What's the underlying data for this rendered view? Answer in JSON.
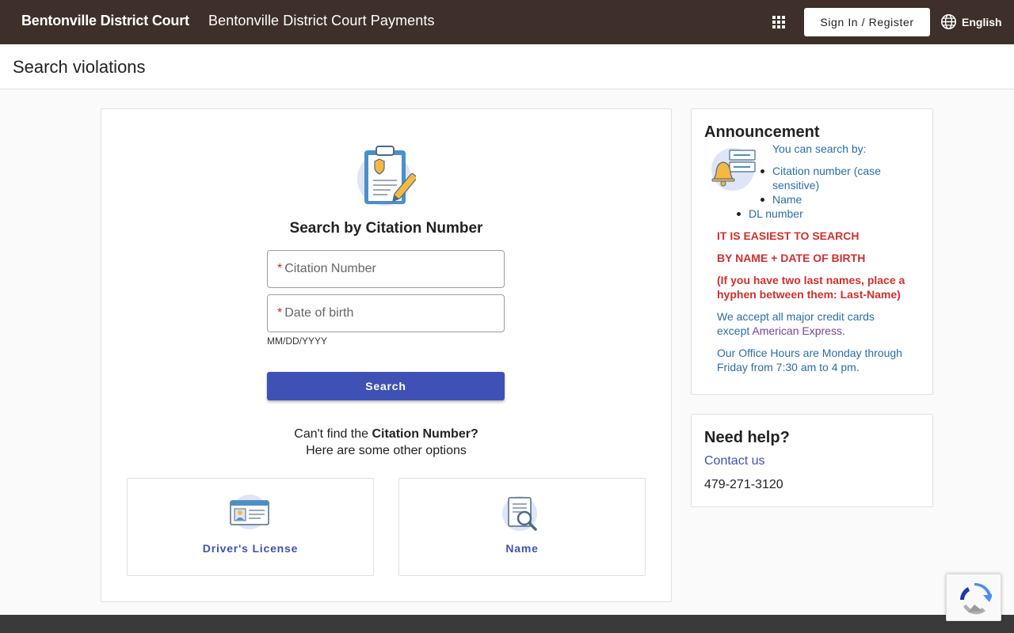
{
  "header": {
    "court_name": "Bentonville District Court",
    "app_title": "Bentonville District Court Payments",
    "signin_label": "Sign In / Register",
    "language": "English"
  },
  "page": {
    "title": "Search violations"
  },
  "search": {
    "heading": "Search by Citation Number",
    "citation_placeholder": "Citation Number",
    "dob_placeholder": "Date of birth",
    "dob_hint": "MM/DD/YYYY",
    "search_label": "Search",
    "cant_find_prefix": "Can't find the ",
    "cant_find_bold": "Citation Number?",
    "other_options": "Here are some other options",
    "options": [
      {
        "label": "Driver's License",
        "icon": "drivers-license-icon"
      },
      {
        "label": "Name",
        "icon": "name-search-icon"
      }
    ]
  },
  "announcement": {
    "title": "Announcement",
    "intro": "You can search by:",
    "items": [
      "Citation number (case sensitive)",
      "Name",
      "DL number"
    ],
    "red_line_1": "IT IS EASIEST TO SEARCH",
    "red_line_2": "BY NAME + DATE OF BIRTH",
    "red_line_3": "(If you have two last names, place a hyphen between them: Last-Name)",
    "cards_text": "We accept all major credit cards except ",
    "cards_amex": "American Express",
    "cards_end": ".",
    "hours": "Our Office Hours are Monday through Friday from 7:30 am to 4 pm."
  },
  "help": {
    "title": "Need help?",
    "contact_label": "Contact us",
    "phone": "479-271-3120"
  },
  "colors": {
    "topbar": "#3e2f2a",
    "primary": "#3f51b5",
    "announcement_text": "#2a6ea8",
    "alert_red": "#d32f2f"
  }
}
